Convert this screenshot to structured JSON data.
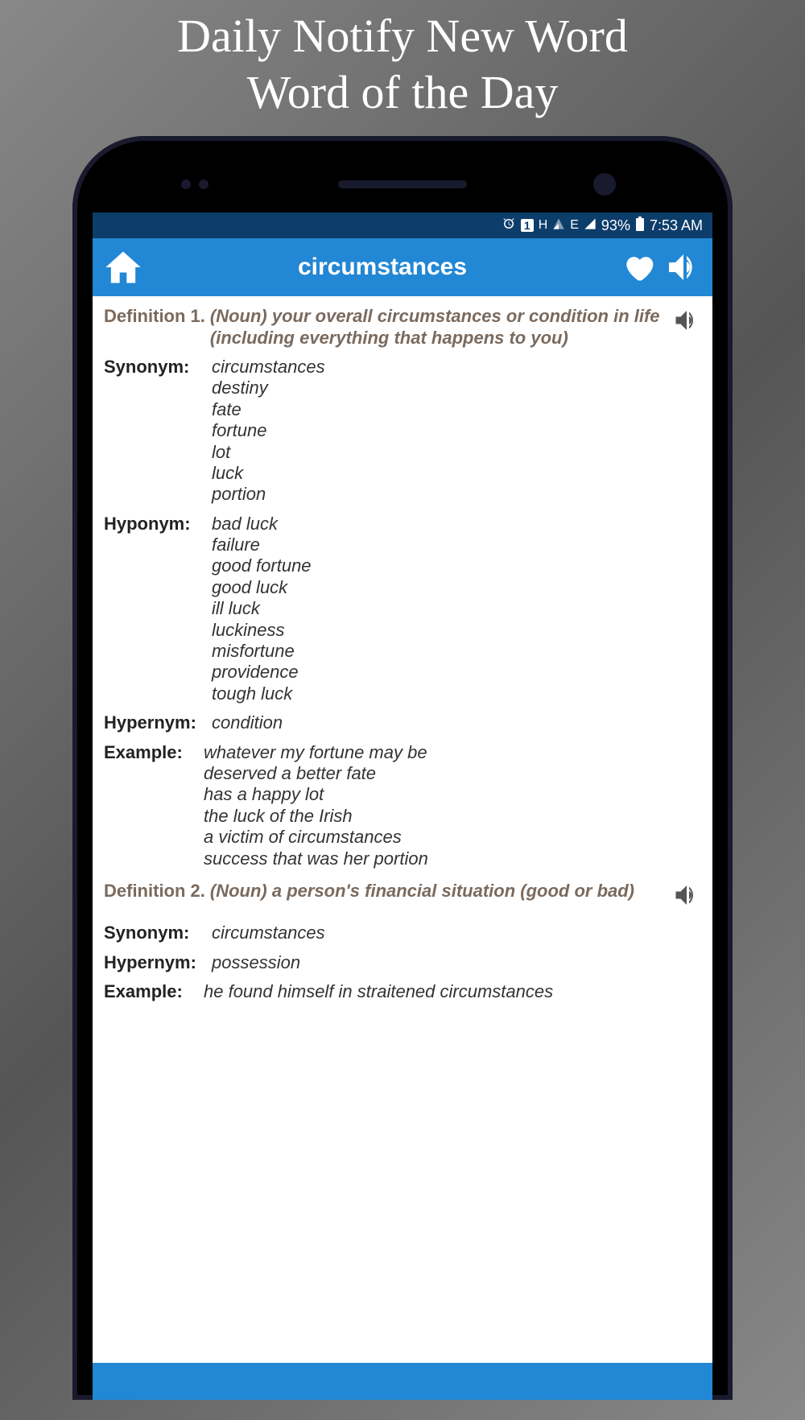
{
  "promo": {
    "line1": "Daily Notify New Word",
    "line2": "Word of the Day"
  },
  "status": {
    "alarm": "⏰",
    "sim": "1",
    "h_label": "H",
    "e_label": "E",
    "battery": "93%",
    "time": "7:53 AM"
  },
  "appbar": {
    "title": "circumstances"
  },
  "definitions": [
    {
      "label": "Definition 1.",
      "text": "(Noun) your overall circumstances or condition in life (including everything that happens to you)",
      "sections": [
        {
          "label": "Synonym:",
          "values": [
            "circumstances",
            "destiny",
            "fate",
            "fortune",
            "lot",
            "luck",
            "portion"
          ]
        },
        {
          "label": "Hyponym:",
          "values": [
            "bad luck",
            "failure",
            "good fortune",
            "good luck",
            "ill luck",
            "luckiness",
            "misfortune",
            "providence",
            "tough luck"
          ]
        },
        {
          "label": "Hypernym:",
          "values": [
            "condition"
          ]
        },
        {
          "label": "Example:",
          "values": [
            "whatever my fortune may be",
            "deserved a better fate",
            "has a happy lot",
            "the luck of the Irish",
            "a victim of circumstances",
            "success that was her portion"
          ]
        }
      ]
    },
    {
      "label": "Definition 2.",
      "text": "(Noun) a person's financial situation (good or bad)",
      "sections": [
        {
          "label": "Synonym:",
          "values": [
            "circumstances"
          ]
        },
        {
          "label": "Hypernym:",
          "values": [
            "possession"
          ]
        },
        {
          "label": "Example:",
          "values": [
            "he found himself in straitened circumstances"
          ]
        }
      ]
    }
  ]
}
